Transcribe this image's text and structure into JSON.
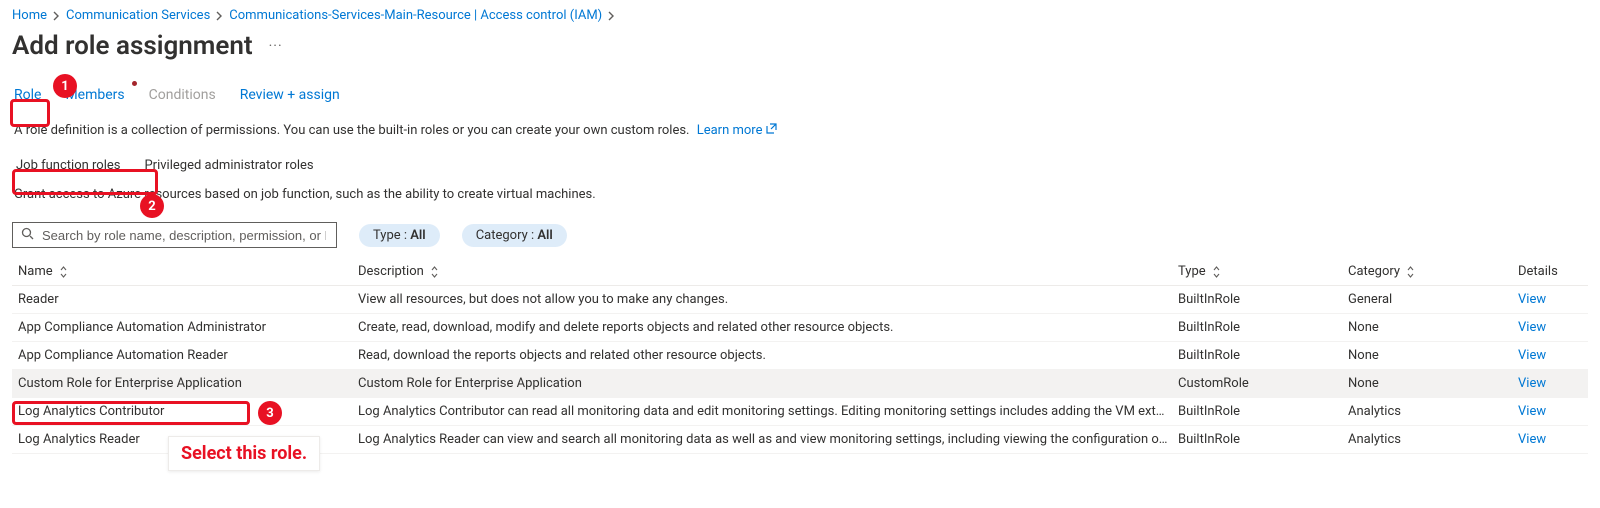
{
  "breadcrumb": {
    "items": [
      {
        "label": "Home"
      },
      {
        "label": "Communication Services"
      },
      {
        "label": "Communications-Services-Main-Resource | Access control (IAM)"
      }
    ]
  },
  "page": {
    "title": "Add role assignment"
  },
  "tabs": {
    "role": "Role",
    "members": "Members",
    "conditions": "Conditions",
    "review": "Review + assign"
  },
  "description": {
    "text": "A role definition is a collection of permissions. You can use the built-in roles or you can create your own custom roles.",
    "learn_more": "Learn more"
  },
  "subtabs": {
    "job": "Job function roles",
    "priv": "Privileged administrator roles"
  },
  "subdesc": "Grant access to Azure resources based on job function, such as the ability to create virtual machines.",
  "search": {
    "placeholder": "Search by role name, description, permission, or ID"
  },
  "filters": {
    "type_label": "Type : ",
    "type_value": "All",
    "cat_label": "Category : ",
    "cat_value": "All"
  },
  "columns": {
    "name": "Name",
    "desc": "Description",
    "type": "Type",
    "cat": "Category",
    "details": "Details"
  },
  "rows": [
    {
      "name": "Reader",
      "desc": "View all resources, but does not allow you to make any changes.",
      "type": "BuiltInRole",
      "cat": "General",
      "details": "View"
    },
    {
      "name": "App Compliance Automation Administrator",
      "desc": "Create, read, download, modify and delete reports objects and related other resource objects.",
      "type": "BuiltInRole",
      "cat": "None",
      "details": "View"
    },
    {
      "name": "App Compliance Automation Reader",
      "desc": "Read, download the reports objects and related other resource objects.",
      "type": "BuiltInRole",
      "cat": "None",
      "details": "View"
    },
    {
      "name": "Custom Role for Enterprise Application",
      "desc": "Custom Role for Enterprise Application",
      "type": "CustomRole",
      "cat": "None",
      "details": "View"
    },
    {
      "name": "Log Analytics Contributor",
      "desc": "Log Analytics Contributor can read all monitoring data and edit monitoring settings. Editing monitoring settings includes adding the VM extension to VMs; …",
      "type": "BuiltInRole",
      "cat": "Analytics",
      "details": "View"
    },
    {
      "name": "Log Analytics Reader",
      "desc": "Log Analytics Reader can view and search all monitoring data as well as and view monitoring settings, including viewing the configuration of Azure diagnos…",
      "type": "BuiltInRole",
      "cat": "Analytics",
      "details": "View"
    }
  ],
  "annotations": {
    "n1": "1",
    "n2": "2",
    "n3": "3",
    "select_text": "Select this role."
  }
}
